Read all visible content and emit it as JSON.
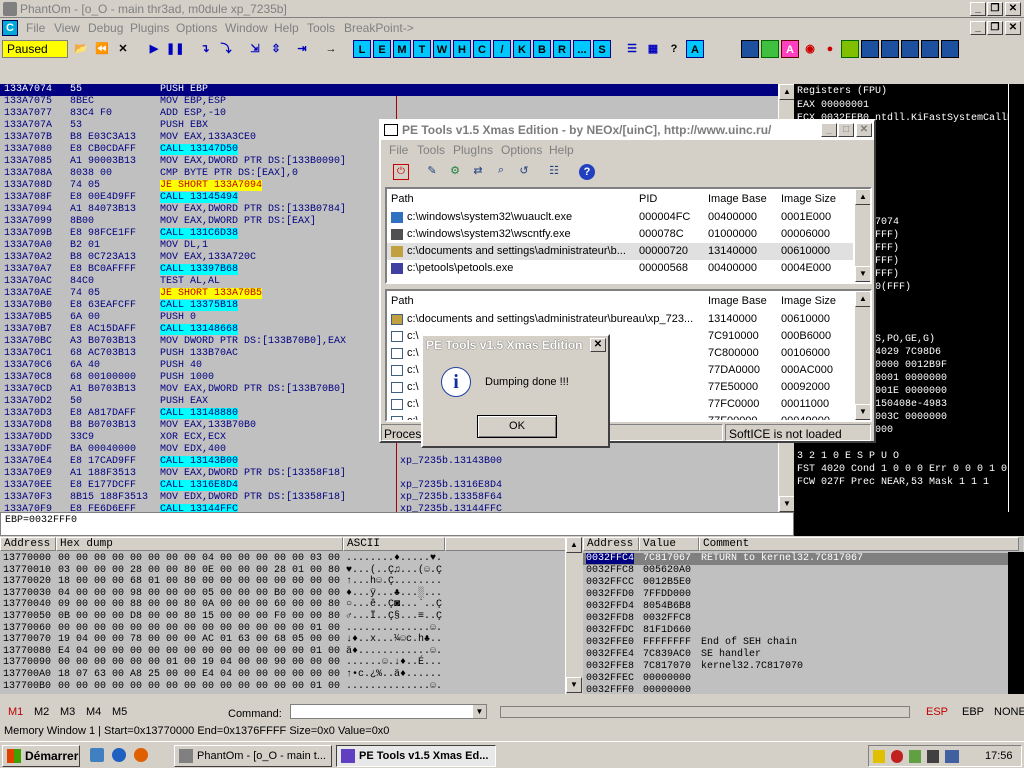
{
  "window": {
    "title": "PhantOm - [o_O - main thr3ad, m0dule xp_7235b]"
  },
  "menu": [
    "File",
    "View",
    "Debug",
    "Plugins",
    "Options",
    "Window",
    "Help",
    "Tools",
    "BreakPoint->"
  ],
  "toolbar": {
    "status": "Paused",
    "letters": [
      "L",
      "E",
      "M",
      "T",
      "W",
      "H",
      "C",
      "/",
      "K",
      "B",
      "R",
      "...",
      "S"
    ]
  },
  "cpu": {
    "rows": [
      {
        "a": "133A7074",
        "h": "55",
        "d": "PUSH EBP",
        "c": "",
        "t": "sel"
      },
      {
        "a": "133A7075",
        "h": "8BEC",
        "d": "MOV EBP,ESP",
        "c": "",
        "t": ""
      },
      {
        "a": "133A7077",
        "h": "83C4 F0",
        "d": "ADD ESP,-10",
        "c": "",
        "t": ""
      },
      {
        "a": "133A707A",
        "h": "53",
        "d": "PUSH EBX",
        "c": "",
        "t": ""
      },
      {
        "a": "133A707B",
        "h": "B8 E03C3A13",
        "d": "MOV EAX,133A3CE0",
        "c": "",
        "t": ""
      },
      {
        "a": "133A7080",
        "h": "E8 CB0CDAFF",
        "d": "CALL 13147D50",
        "c": "",
        "t": "call"
      },
      {
        "a": "133A7085",
        "h": "A1 90003B13",
        "d": "MOV EAX,DWORD PTR DS:[133B0090]",
        "c": "",
        "t": ""
      },
      {
        "a": "133A708A",
        "h": "8038 00",
        "d": "CMP BYTE PTR DS:[EAX],0",
        "c": "",
        "t": ""
      },
      {
        "a": "133A708D",
        "h": "74 05",
        "d": "JE SHORT 133A7094",
        "c": "",
        "t": "jmp"
      },
      {
        "a": "133A708F",
        "h": "E8 00E4D9FF",
        "d": "CALL 13145494",
        "c": "",
        "t": "call"
      },
      {
        "a": "133A7094",
        "h": "A1 84073B13",
        "d": "MOV EAX,DWORD PTR DS:[133B0784]",
        "c": "",
        "t": ""
      },
      {
        "a": "133A7099",
        "h": "8B00",
        "d": "MOV EAX,DWORD PTR DS:[EAX]",
        "c": "",
        "t": ""
      },
      {
        "a": "133A709B",
        "h": "E8 98FCE1FF",
        "d": "CALL 131C6D38",
        "c": "",
        "t": "call"
      },
      {
        "a": "133A70A0",
        "h": "B2 01",
        "d": "MOV DL,1",
        "c": "",
        "t": ""
      },
      {
        "a": "133A70A2",
        "h": "B8 0C723A13",
        "d": "MOV EAX,133A720C",
        "c": "",
        "t": ""
      },
      {
        "a": "133A70A7",
        "h": "E8 BC0AFFFF",
        "d": "CALL 13397B68",
        "c": "",
        "t": "call"
      },
      {
        "a": "133A70AC",
        "h": "84C0",
        "d": "TEST AL,AL",
        "c": "",
        "t": ""
      },
      {
        "a": "133A70AE",
        "h": "74 05",
        "d": "JE SHORT 133A70B5",
        "c": "",
        "t": "jmp"
      },
      {
        "a": "133A70B0",
        "h": "E8 63EAFCFF",
        "d": "CALL 13375B18",
        "c": "",
        "t": "call"
      },
      {
        "a": "133A70B5",
        "h": "6A 00",
        "d": "PUSH 0",
        "c": "",
        "t": ""
      },
      {
        "a": "133A70B7",
        "h": "E8 AC15DAFF",
        "d": "CALL 13148668",
        "c": "",
        "t": "call"
      },
      {
        "a": "133A70BC",
        "h": "A3 B0703B13",
        "d": "MOV DWORD PTR DS:[133B70B0],EAX",
        "c": "",
        "t": ""
      },
      {
        "a": "133A70C1",
        "h": "68 AC703B13",
        "d": "PUSH 133B70AC",
        "c": "",
        "t": ""
      },
      {
        "a": "133A70C6",
        "h": "6A 40",
        "d": "PUSH 40",
        "c": "",
        "t": ""
      },
      {
        "a": "133A70C8",
        "h": "68 00100000",
        "d": "PUSH 1000",
        "c": "",
        "t": ""
      },
      {
        "a": "133A70CD",
        "h": "A1 B0703B13",
        "d": "MOV EAX,DWORD PTR DS:[133B70B0]",
        "c": "",
        "t": ""
      },
      {
        "a": "133A70D2",
        "h": "50",
        "d": "PUSH EAX",
        "c": "",
        "t": ""
      },
      {
        "a": "133A70D3",
        "h": "E8 A817DAFF",
        "d": "CALL 13148880",
        "c": "",
        "t": "call"
      },
      {
        "a": "133A70D8",
        "h": "B8 B0703B13",
        "d": "MOV EAX,133B70B0",
        "c": "",
        "t": ""
      },
      {
        "a": "133A70DD",
        "h": "33C9",
        "d": "XOR ECX,ECX",
        "c": "",
        "t": ""
      },
      {
        "a": "133A70DF",
        "h": "BA 00040000",
        "d": "MOV EDX,400",
        "c": "",
        "t": ""
      },
      {
        "a": "133A70E4",
        "h": "E8 17CAD9FF",
        "d": "CALL 13143B00",
        "c": "xp_7235b.13143B00",
        "t": "call"
      },
      {
        "a": "133A70E9",
        "h": "A1 188F3513",
        "d": "MOV EAX,DWORD PTR DS:[13358F18]",
        "c": "",
        "t": ""
      },
      {
        "a": "133A70EE",
        "h": "E8 E177DCFF",
        "d": "CALL 1316E8D4",
        "c": "xp_7235b.1316E8D4",
        "t": "call"
      },
      {
        "a": "133A70F3",
        "h": "8B15 188F3513",
        "d": "MOV EDX,DWORD PTR DS:[13358F18]",
        "c": "xp_7235b.13358F64",
        "t": ""
      },
      {
        "a": "133A70F9",
        "h": "E8 FE6D6EFF",
        "d": "CALL 13144FFC",
        "c": "xp_7235b.13144FFC",
        "t": "call"
      }
    ],
    "status": "EBP=0032FFF0"
  },
  "registers": {
    "header": "Registers (FPU)",
    "lines": [
      "EAX 00000001",
      "ECX 0032FFB0  ntdll.KiFastSystemCallRet",
      "",
      "",
      "",
      "",
      "",
      "",
      "",
      "                xp_7235b.133A7074",
      "                32bit 0(FFFFFFFF)",
      "                32bit 0(FFFFFFFF)",
      "                32bit 0(FFFFFFFF)",
      "                32bit 0(FFFFFFFF)",
      "                32bit 7FFDF000(FFF)",
      "                NULL",
      "",
      "",
      "                (NO,NB,NE,A,NS,PO,GE,G)",
      "                DRM 401C 7C924029 7C98D6",
      "                DRM 003C 00000000 0012B9F",
      "                DRM 0156 00000001 0000000",
      "                DRM 0002 0000001E 0000000",
      "                1921449925359150408e-4983",
      "                DRM 0045 0200003C 0000000",
      "                0000000000000000",
      "",
      "                3 2 1 0      E S P U O",
      "FST 4020  Cond 1 0 0 0  Err 0 0 0 1 0",
      "FCW 027F  Prec NEAR,53  Mask    1 1 1"
    ]
  },
  "pe_tools": {
    "title": "PE Tools v1.5 Xmas Edition - by NEOx/[uinC], http://www.uinc.ru/",
    "menu": [
      "File",
      "Tools",
      "PlugIns",
      "Options",
      "Help"
    ],
    "proc_headers": [
      "Path",
      "PID",
      "Image Base",
      "Image Size"
    ],
    "processes": [
      {
        "path": "c:\\windows\\system32\\wuauclt.exe",
        "pid": "000004FC",
        "base": "00400000",
        "size": "0001E000"
      },
      {
        "path": "c:\\windows\\system32\\wscntfy.exe",
        "pid": "000078C",
        "base": "01000000",
        "size": "00006000"
      },
      {
        "path": "c:\\documents and settings\\administrateur\\b...",
        "pid": "00000720",
        "base": "13140000",
        "size": "00610000"
      },
      {
        "path": "c:\\petools\\petools.exe",
        "pid": "00000568",
        "base": "00400000",
        "size": "0004E000"
      }
    ],
    "mod_headers": [
      "Path",
      "Image Base",
      "Image Size"
    ],
    "modules": [
      {
        "path": "c:\\documents and settings\\administrateur\\bureau\\xp_723...",
        "base": "13140000",
        "size": "00610000"
      },
      {
        "path": "c:\\",
        "base": "7C910000",
        "size": "000B6000"
      },
      {
        "path": "c:\\",
        "base": "7C800000",
        "size": "00106000"
      },
      {
        "path": "c:\\",
        "base": "77DA0000",
        "size": "000AC000"
      },
      {
        "path": "c:\\",
        "base": "77E50000",
        "size": "00092000"
      },
      {
        "path": "c:\\",
        "base": "77FC0000",
        "size": "00011000"
      },
      {
        "path": "c:\\",
        "base": "77F00000",
        "size": "00049000"
      }
    ],
    "status_left": "Process",
    "status_right": "SoftICE is not loaded"
  },
  "dialog": {
    "title": "PE Tools v1.5 Xmas Edition",
    "message": "Dumping done !!!",
    "ok": "OK"
  },
  "dump": {
    "headers": [
      "Address",
      "Hex dump",
      "ASCII"
    ],
    "rows": [
      {
        "a": "13770000",
        "h": "00 00 00 00 00 00 00 00 04 00 00 00 00 00 03 00",
        "s": "........♦.....♥."
      },
      {
        "a": "13770010",
        "h": "03 00 00 00 28 00 00 80 0E 00 00 00 28 01 00 80",
        "s": "♥...(..Ç♫...(☺.Ç"
      },
      {
        "a": "13770020",
        "h": "18 00 00 00 68 01 00 80 00 00 00 00 00 00 00 00",
        "s": "↑...h☺.Ç........"
      },
      {
        "a": "13770030",
        "h": "04 00 00 00 98 00 00 00 05 00 00 00 B0 00 00 00",
        "s": "♦...ÿ...♣...░..."
      },
      {
        "a": "13770040",
        "h": "09 00 00 00 88 00 00 80 0A 00 00 00 60 00 00 80",
        "s": "○...ê..Ç◙...`..Ç"
      },
      {
        "a": "13770050",
        "h": "0B 00 00 00 D8 00 00 80 15 00 00 00 F0 00 00 80",
        "s": "♂...Ï..Ç§...≡..Ç"
      },
      {
        "a": "13770060",
        "h": "00 00 00 00 00 00 00 00 00 00 00 00 00 00 01 00",
        "s": "..............☺."
      },
      {
        "a": "13770070",
        "h": "19 04 00 00 78 00 00 00 AC 01 63 00 68 05 00 00",
        "s": "↓♦..x...¼☺c.h♣.."
      },
      {
        "a": "13770080",
        "h": "E4 04 00 00 00 00 00 00 00 00 00 00 00 00 01 00",
        "s": "ä♦............☺."
      },
      {
        "a": "13770090",
        "h": "00 00 00 00 00 00 01 00 19 04 00 00 90 00 00 00",
        "s": "......☺.↓♦..É..."
      },
      {
        "a": "137700A0",
        "h": "18 07 63 00 A8 25 00 00 E4 04 00 00 00 00 00 00",
        "s": "↑•c.¿%..ä♦......"
      },
      {
        "a": "137700B0",
        "h": "00 00 00 00 00 00 00 00 00 00 00 00 00 00 01 00",
        "s": "..............☺."
      }
    ]
  },
  "stack": {
    "headers": [
      "Address",
      "Value",
      "Comment"
    ],
    "rows": [
      {
        "a": "0032FFC4",
        "v": "7C817067",
        "c": "RETURN to kernel32.7C817067"
      },
      {
        "a": "0032FFC8",
        "v": "005620A0",
        "c": ""
      },
      {
        "a": "0032FFCC",
        "v": "0012B5E0",
        "c": ""
      },
      {
        "a": "0032FFD0",
        "v": "7FFDD000",
        "c": ""
      },
      {
        "a": "0032FFD4",
        "v": "8054B6B8",
        "c": ""
      },
      {
        "a": "0032FFD8",
        "v": "0032FFC8",
        "c": ""
      },
      {
        "a": "0032FFDC",
        "v": "81F1D660",
        "c": ""
      },
      {
        "a": "0032FFE0",
        "v": "FFFFFFFF",
        "c": "End of SEH chain"
      },
      {
        "a": "0032FFE4",
        "v": "7C839AC0",
        "c": "SE handler"
      },
      {
        "a": "0032FFE8",
        "v": "7C817070",
        "c": "kernel32.7C817070"
      },
      {
        "a": "0032FFEC",
        "v": "00000000",
        "c": ""
      },
      {
        "a": "0032FFF0",
        "v": "00000000",
        "c": ""
      }
    ]
  },
  "bottom": {
    "tabs": [
      "M1",
      "M2",
      "M3",
      "M4",
      "M5"
    ],
    "command_label": "Command:",
    "regs": [
      "ESP",
      "EBP",
      "NONE"
    ],
    "info": "Memory Window 1 | Start=0x13770000 End=0x1376FFFF Size=0x0 Value=0x0"
  },
  "taskbar": {
    "start": "Démarrer",
    "tasks": [
      "PhantOm - [o_O - main t...",
      "PE Tools v1.5 Xmas Ed..."
    ],
    "clock": "17:56"
  }
}
